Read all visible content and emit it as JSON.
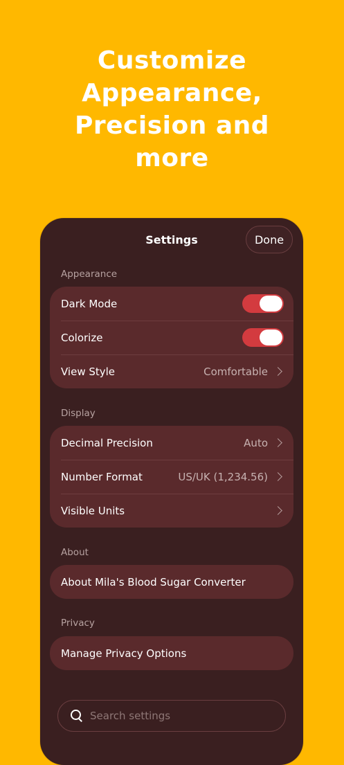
{
  "headline": {
    "line1": "Customize",
    "line2": "Appearance,",
    "line3": "Precision and",
    "line4": "more"
  },
  "settings": {
    "title": "Settings",
    "done_label": "Done",
    "sections": {
      "appearance": {
        "label": "Appearance",
        "dark_mode": {
          "label": "Dark Mode",
          "on": true
        },
        "colorize": {
          "label": "Colorize",
          "on": true
        },
        "view_style": {
          "label": "View Style",
          "value": "Comfortable"
        }
      },
      "display": {
        "label": "Display",
        "decimal_precision": {
          "label": "Decimal Precision",
          "value": "Auto"
        },
        "number_format": {
          "label": "Number Format",
          "value": "US/UK (1,234.56)"
        },
        "visible_units": {
          "label": "Visible Units"
        }
      },
      "about": {
        "label": "About",
        "about_app": {
          "label": "About Mila's Blood Sugar Converter"
        }
      },
      "privacy": {
        "label": "Privacy",
        "manage": {
          "label": "Manage Privacy Options"
        }
      }
    },
    "search": {
      "placeholder": "Search settings"
    }
  },
  "colors": {
    "background": "#FFB800",
    "panel": "#3a1f20",
    "group": "#5a2a2c",
    "toggle_on": "#d33b3f"
  }
}
